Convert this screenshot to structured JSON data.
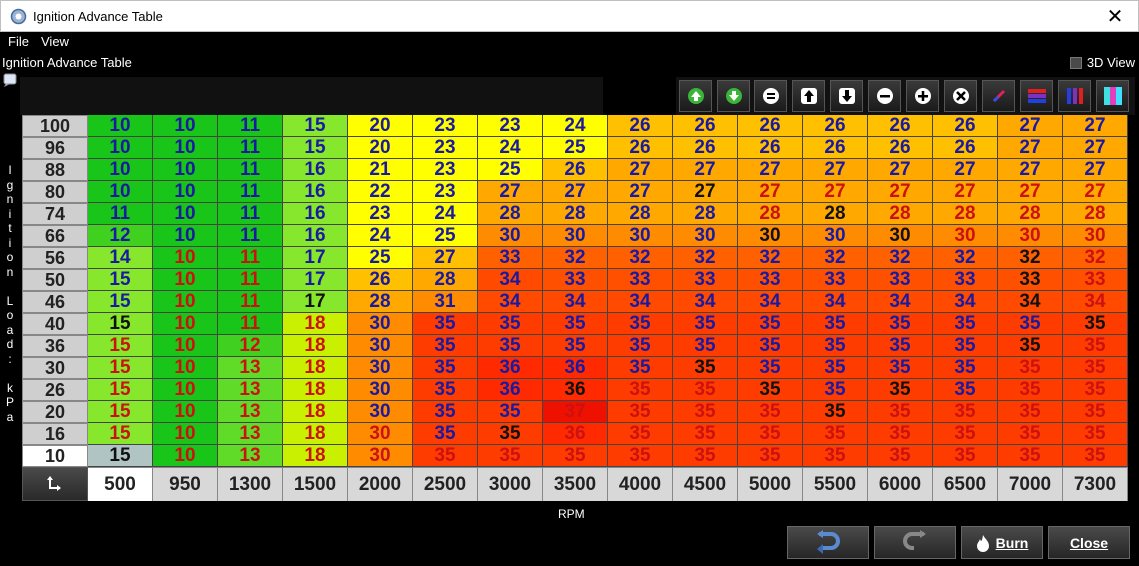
{
  "window": {
    "title": "Ignition Advance Table",
    "close_glyph": "✕"
  },
  "menu": {
    "file": "File",
    "view": "View"
  },
  "panel": {
    "title": "Ignition Advance Table",
    "view3d_label": "3D View",
    "view3d_checked": false
  },
  "toolbar": {
    "buttons": [
      {
        "icon": "green-up-arrow-icon"
      },
      {
        "icon": "green-down-arrow-icon"
      },
      {
        "icon": "equals-icon"
      },
      {
        "icon": "increment-up-icon"
      },
      {
        "icon": "decrement-down-icon"
      },
      {
        "icon": "minus-icon"
      },
      {
        "icon": "plus-icon"
      },
      {
        "icon": "multiply-icon"
      },
      {
        "icon": "interpolate-icon"
      },
      {
        "icon": "horizontal-interpolate-icon"
      },
      {
        "icon": "vertical-interpolate-icon"
      },
      {
        "icon": "color-scale-icon"
      }
    ]
  },
  "axis": {
    "y_label": "Ignition Load: kPa",
    "x_label": "RPM",
    "load": [
      "100",
      "96",
      "88",
      "80",
      "74",
      "66",
      "56",
      "50",
      "46",
      "40",
      "36",
      "30",
      "26",
      "20",
      "16",
      "10"
    ],
    "rpm": [
      "500",
      "950",
      "1300",
      "1500",
      "2000",
      "2500",
      "3000",
      "3500",
      "4000",
      "4500",
      "5000",
      "5500",
      "6000",
      "6500",
      "7000",
      "7300"
    ],
    "active_load": "10",
    "active_rpm": "500"
  },
  "table": [
    [
      "10",
      "10",
      "11",
      "15",
      "20",
      "23",
      "23",
      "24",
      "26",
      "26",
      "26",
      "26",
      "26",
      "26",
      "27",
      "27"
    ],
    [
      "10",
      "10",
      "11",
      "15",
      "20",
      "23",
      "24",
      "25",
      "26",
      "26",
      "26",
      "26",
      "26",
      "26",
      "27",
      "27"
    ],
    [
      "10",
      "10",
      "11",
      "16",
      "21",
      "23",
      "25",
      "26",
      "27",
      "27",
      "27",
      "27",
      "27",
      "27",
      "27",
      "27"
    ],
    [
      "10",
      "10",
      "11",
      "16",
      "22",
      "23",
      "27",
      "27",
      "27",
      "27",
      "27",
      "27",
      "27",
      "27",
      "27",
      "27"
    ],
    [
      "11",
      "10",
      "11",
      "16",
      "23",
      "24",
      "28",
      "28",
      "28",
      "28",
      "28",
      "28",
      "28",
      "28",
      "28",
      "28"
    ],
    [
      "12",
      "10",
      "11",
      "16",
      "24",
      "25",
      "30",
      "30",
      "30",
      "30",
      "30",
      "30",
      "30",
      "30",
      "30",
      "30"
    ],
    [
      "14",
      "10",
      "11",
      "17",
      "25",
      "27",
      "33",
      "32",
      "32",
      "32",
      "32",
      "32",
      "32",
      "32",
      "32",
      "32"
    ],
    [
      "15",
      "10",
      "11",
      "17",
      "26",
      "28",
      "34",
      "33",
      "33",
      "33",
      "33",
      "33",
      "33",
      "33",
      "33",
      "33"
    ],
    [
      "15",
      "10",
      "11",
      "17",
      "28",
      "31",
      "34",
      "34",
      "34",
      "34",
      "34",
      "34",
      "34",
      "34",
      "34",
      "34"
    ],
    [
      "15",
      "10",
      "11",
      "18",
      "30",
      "35",
      "35",
      "35",
      "35",
      "35",
      "35",
      "35",
      "35",
      "35",
      "35",
      "35"
    ],
    [
      "15",
      "10",
      "12",
      "18",
      "30",
      "35",
      "35",
      "35",
      "35",
      "35",
      "35",
      "35",
      "35",
      "35",
      "35",
      "35"
    ],
    [
      "15",
      "10",
      "13",
      "18",
      "30",
      "35",
      "36",
      "36",
      "35",
      "35",
      "35",
      "35",
      "35",
      "35",
      "35",
      "35"
    ],
    [
      "15",
      "10",
      "13",
      "18",
      "30",
      "35",
      "36",
      "36",
      "35",
      "35",
      "35",
      "35",
      "35",
      "35",
      "35",
      "35"
    ],
    [
      "15",
      "10",
      "13",
      "18",
      "30",
      "35",
      "35",
      "37",
      "35",
      "35",
      "35",
      "35",
      "35",
      "35",
      "35",
      "35"
    ],
    [
      "15",
      "10",
      "13",
      "18",
      "30",
      "35",
      "35",
      "36",
      "35",
      "35",
      "35",
      "35",
      "35",
      "35",
      "35",
      "35"
    ],
    [
      "15",
      "10",
      "13",
      "18",
      "30",
      "35",
      "35",
      "35",
      "35",
      "35",
      "35",
      "35",
      "35",
      "35",
      "35",
      "35"
    ]
  ],
  "cell_bg": [
    [
      "#19c519",
      "#19c519",
      "#19c519",
      "#86e72c",
      "#ffff00",
      "#ffff00",
      "#ffff00",
      "#ffff00",
      "#ffc000",
      "#ffc000",
      "#ffc000",
      "#ffc000",
      "#ffc000",
      "#ffc000",
      "#ffa800",
      "#ffa800"
    ],
    [
      "#19c519",
      "#19c519",
      "#19c519",
      "#86e72c",
      "#ffff00",
      "#ffff00",
      "#ffff00",
      "#ffff00",
      "#ffc000",
      "#ffc000",
      "#ffc000",
      "#ffc000",
      "#ffc000",
      "#ffc000",
      "#ffa800",
      "#ffa800"
    ],
    [
      "#19c519",
      "#19c519",
      "#19c519",
      "#86e72c",
      "#ffff00",
      "#ffff00",
      "#ffff00",
      "#ffc000",
      "#ffa800",
      "#ffa800",
      "#ffa800",
      "#ffa800",
      "#ffa800",
      "#ffa800",
      "#ffa800",
      "#ffa800"
    ],
    [
      "#19c519",
      "#19c519",
      "#19c519",
      "#86e72c",
      "#ffff00",
      "#ffff00",
      "#ffa800",
      "#ffa800",
      "#ffa800",
      "#ffa800",
      "#ffa800",
      "#ffa800",
      "#ffa800",
      "#ffa800",
      "#ffa800",
      "#ffa800"
    ],
    [
      "#19c519",
      "#19c519",
      "#19c519",
      "#86e72c",
      "#ffff00",
      "#ffff00",
      "#ffa800",
      "#ffa800",
      "#ffa800",
      "#ffa800",
      "#ffa800",
      "#ffa800",
      "#ffa800",
      "#ffa800",
      "#ffa800",
      "#ffa800"
    ],
    [
      "#40d020",
      "#19c519",
      "#19c519",
      "#86e72c",
      "#ffff00",
      "#ffff00",
      "#ff8c00",
      "#ff8c00",
      "#ff8c00",
      "#ff8c00",
      "#ff8c00",
      "#ff8c00",
      "#ff8c00",
      "#ff8c00",
      "#ff8c00",
      "#ff8c00"
    ],
    [
      "#86e72c",
      "#19c519",
      "#19c519",
      "#86e72c",
      "#ffff00",
      "#ffc000",
      "#ff6000",
      "#ff6000",
      "#ff6000",
      "#ff6000",
      "#ff6000",
      "#ff6000",
      "#ff6000",
      "#ff6000",
      "#ff6000",
      "#ff6000"
    ],
    [
      "#86e72c",
      "#19c519",
      "#19c519",
      "#86e72c",
      "#ffc000",
      "#ffa800",
      "#ff4a00",
      "#ff5000",
      "#ff5000",
      "#ff5000",
      "#ff5000",
      "#ff5000",
      "#ff5000",
      "#ff5000",
      "#ff5000",
      "#ff5000"
    ],
    [
      "#86e72c",
      "#19c519",
      "#19c519",
      "#86e72c",
      "#ffa800",
      "#ff8c00",
      "#ff4a00",
      "#ff4a00",
      "#ff4a00",
      "#ff4a00",
      "#ff4a00",
      "#ff4a00",
      "#ff4a00",
      "#ff4a00",
      "#ff4a00",
      "#ff4a00"
    ],
    [
      "#86e72c",
      "#19c519",
      "#19c519",
      "#c8f000",
      "#ff8c00",
      "#ff3c00",
      "#ff3c00",
      "#ff3c00",
      "#ff3c00",
      "#ff3c00",
      "#ff3c00",
      "#ff3c00",
      "#ff3c00",
      "#ff3c00",
      "#ff3c00",
      "#ff3c00"
    ],
    [
      "#86e72c",
      "#19c519",
      "#40d020",
      "#c8f000",
      "#ff8c00",
      "#ff3c00",
      "#ff3c00",
      "#ff3c00",
      "#ff3c00",
      "#ff3c00",
      "#ff3c00",
      "#ff3c00",
      "#ff3c00",
      "#ff3c00",
      "#ff3c00",
      "#ff3c00"
    ],
    [
      "#86e72c",
      "#19c519",
      "#60dc28",
      "#c8f000",
      "#ff8c00",
      "#ff3c00",
      "#ff2a00",
      "#ff2a00",
      "#ff3c00",
      "#ff3c00",
      "#ff3c00",
      "#ff3c00",
      "#ff3c00",
      "#ff3c00",
      "#ff3c00",
      "#ff3c00"
    ],
    [
      "#86e72c",
      "#19c519",
      "#60dc28",
      "#c8f000",
      "#ff8c00",
      "#ff3c00",
      "#ff2a00",
      "#ff2a00",
      "#ff3c00",
      "#ff3c00",
      "#ff3c00",
      "#ff3c00",
      "#ff3c00",
      "#ff3c00",
      "#ff3c00",
      "#ff3c00"
    ],
    [
      "#86e72c",
      "#19c519",
      "#60dc28",
      "#c8f000",
      "#ff8c00",
      "#ff3c00",
      "#ff3c00",
      "#ee1100",
      "#ff3c00",
      "#ff3c00",
      "#ff3c00",
      "#ff3c00",
      "#ff3c00",
      "#ff3c00",
      "#ff3c00",
      "#ff3c00"
    ],
    [
      "#86e72c",
      "#19c519",
      "#60dc28",
      "#c8f000",
      "#ff8c00",
      "#ff3c00",
      "#ff3c00",
      "#ff2a00",
      "#ff3c00",
      "#ff3c00",
      "#ff3c00",
      "#ff3c00",
      "#ff3c00",
      "#ff3c00",
      "#ff3c00",
      "#ff3c00"
    ],
    [
      "#b0c4c4",
      "#19c519",
      "#60dc28",
      "#c8f000",
      "#ff8c00",
      "#ff3c00",
      "#ff3c00",
      "#ff3c00",
      "#ff3c00",
      "#ff3c00",
      "#ff3c00",
      "#ff3c00",
      "#ff3c00",
      "#ff3c00",
      "#ff3c00",
      "#ff3c00"
    ]
  ],
  "cell_fg": [
    [
      "#1a1aa0",
      "#1a1aa0",
      "#1a1aa0",
      "#1a1aa0",
      "#1a1aa0",
      "#1a1aa0",
      "#1a1aa0",
      "#1a1aa0",
      "#1a1aa0",
      "#1a1aa0",
      "#1a1aa0",
      "#1a1aa0",
      "#1a1aa0",
      "#1a1aa0",
      "#1a1aa0",
      "#1a1aa0"
    ],
    [
      "#1a1aa0",
      "#1a1aa0",
      "#1a1aa0",
      "#1a1aa0",
      "#1a1aa0",
      "#1a1aa0",
      "#1a1aa0",
      "#1a1aa0",
      "#1a1aa0",
      "#1a1aa0",
      "#1a1aa0",
      "#1a1aa0",
      "#1a1aa0",
      "#1a1aa0",
      "#1a1aa0",
      "#1a1aa0"
    ],
    [
      "#1a1aa0",
      "#1a1aa0",
      "#1a1aa0",
      "#1a1aa0",
      "#1a1aa0",
      "#1a1aa0",
      "#1a1aa0",
      "#1a1aa0",
      "#1a1aa0",
      "#1a1aa0",
      "#1a1aa0",
      "#1a1aa0",
      "#1a1aa0",
      "#1a1aa0",
      "#1a1aa0",
      "#1a1aa0"
    ],
    [
      "#1a1aa0",
      "#1a1aa0",
      "#1a1aa0",
      "#1a1aa0",
      "#1a1aa0",
      "#1a1aa0",
      "#1a1aa0",
      "#1a1aa0",
      "#1a1aa0",
      "#111111",
      "#cc1111",
      "#cc1111",
      "#cc1111",
      "#cc1111",
      "#cc1111",
      "#cc1111"
    ],
    [
      "#1a1aa0",
      "#1a1aa0",
      "#1a1aa0",
      "#1a1aa0",
      "#1a1aa0",
      "#1a1aa0",
      "#1a1aa0",
      "#1a1aa0",
      "#1a1aa0",
      "#1a1aa0",
      "#cc1111",
      "#111111",
      "#cc1111",
      "#cc1111",
      "#cc1111",
      "#cc1111"
    ],
    [
      "#1a1aa0",
      "#1a1aa0",
      "#1a1aa0",
      "#1a1aa0",
      "#1a1aa0",
      "#1a1aa0",
      "#1a1aa0",
      "#1a1aa0",
      "#1a1aa0",
      "#1a1aa0",
      "#111111",
      "#1a1aa0",
      "#111111",
      "#cc1111",
      "#cc1111",
      "#cc1111"
    ],
    [
      "#1a1aa0",
      "#cc1111",
      "#cc1111",
      "#1a1aa0",
      "#1a1aa0",
      "#1a1aa0",
      "#1a1aa0",
      "#1a1aa0",
      "#1a1aa0",
      "#1a1aa0",
      "#1a1aa0",
      "#1a1aa0",
      "#1a1aa0",
      "#1a1aa0",
      "#111111",
      "#cc1111"
    ],
    [
      "#1a1aa0",
      "#cc1111",
      "#cc1111",
      "#1a1aa0",
      "#1a1aa0",
      "#1a1aa0",
      "#1a1aa0",
      "#1a1aa0",
      "#1a1aa0",
      "#1a1aa0",
      "#1a1aa0",
      "#1a1aa0",
      "#1a1aa0",
      "#1a1aa0",
      "#111111",
      "#cc1111"
    ],
    [
      "#1a1aa0",
      "#cc1111",
      "#cc1111",
      "#111111",
      "#1a1aa0",
      "#1a1aa0",
      "#1a1aa0",
      "#1a1aa0",
      "#1a1aa0",
      "#1a1aa0",
      "#1a1aa0",
      "#1a1aa0",
      "#1a1aa0",
      "#1a1aa0",
      "#111111",
      "#cc1111"
    ],
    [
      "#111111",
      "#cc1111",
      "#cc1111",
      "#cc1111",
      "#1a1aa0",
      "#1a1aa0",
      "#1a1aa0",
      "#1a1aa0",
      "#1a1aa0",
      "#1a1aa0",
      "#1a1aa0",
      "#1a1aa0",
      "#1a1aa0",
      "#1a1aa0",
      "#1a1aa0",
      "#111111"
    ],
    [
      "#cc1111",
      "#cc1111",
      "#cc1111",
      "#cc1111",
      "#1a1aa0",
      "#1a1aa0",
      "#1a1aa0",
      "#1a1aa0",
      "#1a1aa0",
      "#1a1aa0",
      "#1a1aa0",
      "#1a1aa0",
      "#1a1aa0",
      "#1a1aa0",
      "#111111",
      "#cc1111"
    ],
    [
      "#cc1111",
      "#cc1111",
      "#cc1111",
      "#cc1111",
      "#1a1aa0",
      "#1a1aa0",
      "#1a1aa0",
      "#1a1aa0",
      "#1a1aa0",
      "#111111",
      "#1a1aa0",
      "#1a1aa0",
      "#1a1aa0",
      "#1a1aa0",
      "#cc1111",
      "#cc1111"
    ],
    [
      "#cc1111",
      "#cc1111",
      "#cc1111",
      "#cc1111",
      "#1a1aa0",
      "#1a1aa0",
      "#1a1aa0",
      "#111111",
      "#cc1111",
      "#cc1111",
      "#111111",
      "#1a1aa0",
      "#111111",
      "#1a1aa0",
      "#cc1111",
      "#cc1111"
    ],
    [
      "#cc1111",
      "#cc1111",
      "#cc1111",
      "#cc1111",
      "#1a1aa0",
      "#1a1aa0",
      "#1a1aa0",
      "#cc1111",
      "#cc1111",
      "#cc1111",
      "#cc1111",
      "#111111",
      "#cc1111",
      "#cc1111",
      "#cc1111",
      "#cc1111"
    ],
    [
      "#cc1111",
      "#cc1111",
      "#cc1111",
      "#cc1111",
      "#cc1111",
      "#1a1aa0",
      "#111111",
      "#cc1111",
      "#cc1111",
      "#cc1111",
      "#cc1111",
      "#cc1111",
      "#cc1111",
      "#cc1111",
      "#cc1111",
      "#cc1111"
    ],
    [
      "#111111",
      "#cc1111",
      "#cc1111",
      "#cc1111",
      "#cc1111",
      "#cc1111",
      "#cc1111",
      "#cc1111",
      "#cc1111",
      "#cc1111",
      "#cc1111",
      "#cc1111",
      "#cc1111",
      "#cc1111",
      "#cc1111",
      "#cc1111"
    ]
  ],
  "bottom": {
    "undo_icon": "undo-icon",
    "redo_icon": "redo-icon",
    "burn_label": "Burn",
    "burn_icon": "flame-icon",
    "close_label": "Close"
  }
}
